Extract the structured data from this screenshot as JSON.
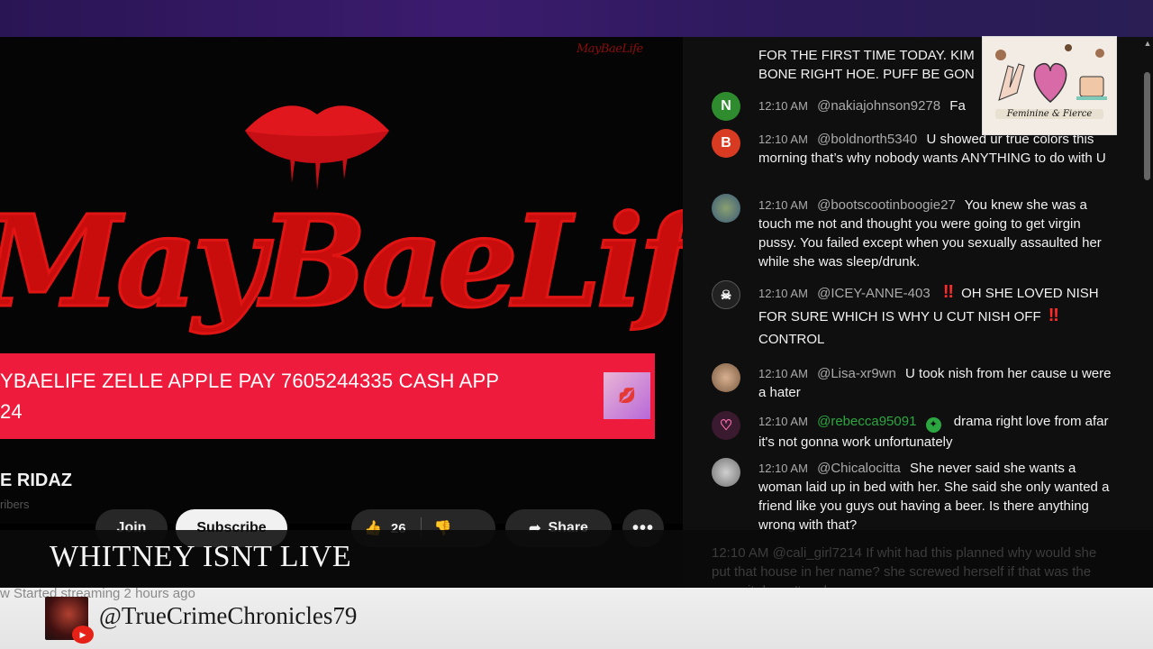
{
  "video": {
    "corner_logo": "MayBaeLife",
    "banner_title": "MayBaeLife",
    "donation_line1": "YBAELIFE ZELLE APPLE PAY 7605244335 CASH APP",
    "donation_line2": "24",
    "channel_name": "E RIDAZ",
    "channel_subs": "ribers",
    "buttons": {
      "join": "Join",
      "subscribe": "Subscribe",
      "like_count": "26",
      "share": "Share",
      "more": "•••"
    },
    "status_line": "w  Started streaming 2 hours ago"
  },
  "chat": {
    "partial_top_line1": "FOR THE FIRST TIME TODAY. KIM",
    "partial_top_line2": "BONE RIGHT HOE. PUFF BE GON",
    "messages": [
      {
        "time": "12:10 AM",
        "author": "@nakiajohnson9278",
        "text": "Fa",
        "avatar_letter": "N",
        "avatar_color": "#2e8b2e"
      },
      {
        "time": "12:10 AM",
        "author": "@boldnorth5340",
        "text": "U showed ur true colors this morning that’s why nobody wants ANYTHING to do with U",
        "avatar_letter": "B",
        "avatar_color": "#d93b22"
      },
      {
        "time": "12:10 AM",
        "author": "@bootscootinboogie27",
        "text": "You knew she was a touch me not and thought you were going to get virgin pussy. You failed except when you sexually assaulted her while she was sleep/drunk.",
        "avatar_letter": "",
        "avatar_color": "#4d6b8a"
      },
      {
        "time": "12:10 AM",
        "author": "@ICEY-ANNE-403",
        "text1": "OH SHE LOVED NISH FOR SURE WHICH IS WHY U CUT NISH OFF",
        "bang": "‼",
        "text2": "CONTROL",
        "avatar_letter": "",
        "avatar_color": "#222"
      },
      {
        "time": "12:10 AM",
        "author": "@Lisa-xr9wn",
        "text": "U took nish from her cause u were a hater",
        "avatar_letter": "",
        "avatar_color": "#a07a60"
      },
      {
        "time": "12:10 AM",
        "author": "@rebecca95091",
        "text": "drama right love from afar it's not gonna work unfortunately",
        "avatar_letter": "♡",
        "avatar_color": "#3a1a2e"
      },
      {
        "time": "12:10 AM",
        "author": "@Chicalocitta",
        "text": "She never said she wants a woman laid up in bed with her. She said she only wanted a friend like you guys out having a beer. Is there anything wrong with that?",
        "avatar_letter": "",
        "avatar_color": "#9a9a9a"
      }
    ],
    "faded_message": {
      "time": "12:10 AM",
      "author": "@cali_girl7214",
      "text": "If whit had this planned why would she put that house in her name? she screwed herself if that was the case..it doesn't make sense"
    }
  },
  "sticker": {
    "caption": "Feminine & Fierce"
  },
  "overlay": {
    "title": "WHITNEY ISNT LIVE",
    "handle": "@TrueCrimeChronicles79"
  },
  "colors": {
    "banner_red": "#ef1b3c",
    "member_green": "#2ba640",
    "chat_bg": "#0f0f0f"
  }
}
